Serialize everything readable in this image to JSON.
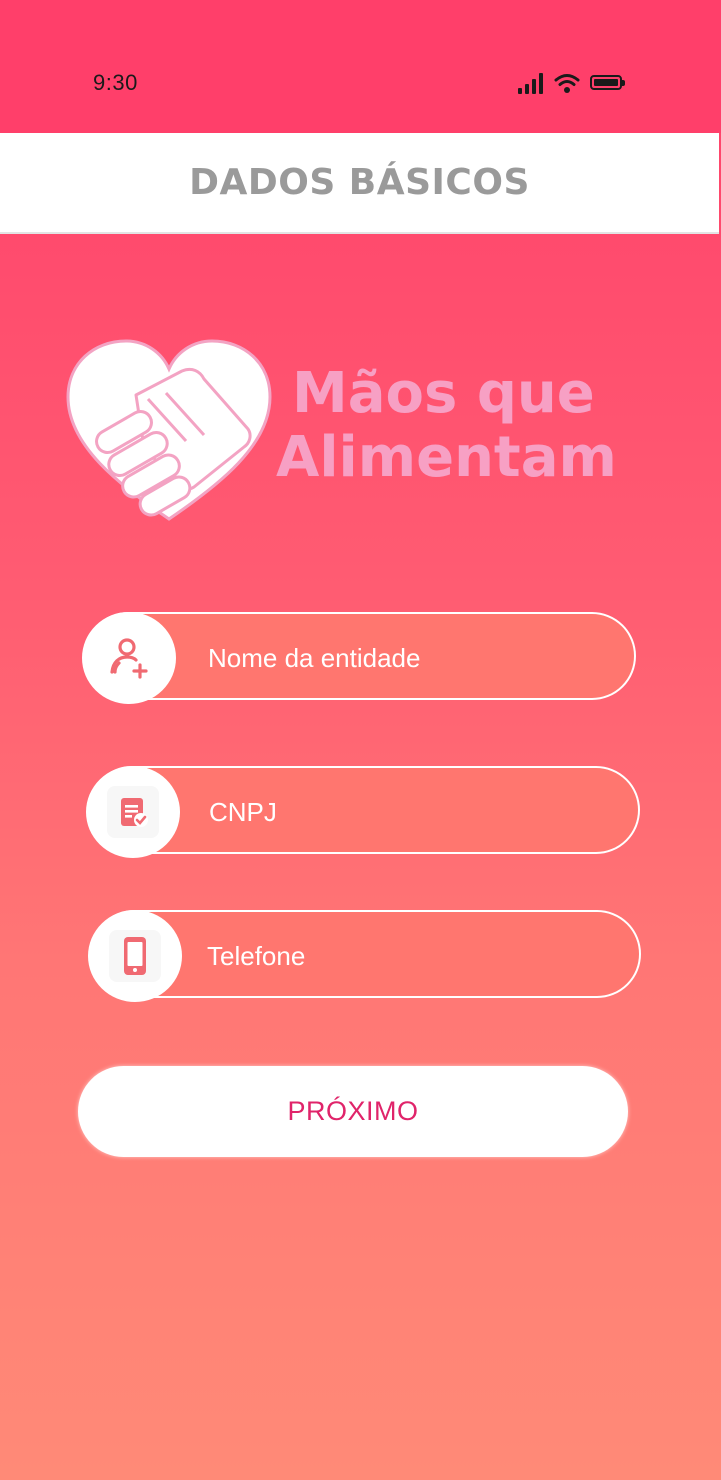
{
  "status_bar": {
    "time": "9:30",
    "icons": [
      "signal-icon",
      "wifi-icon",
      "battery-icon"
    ]
  },
  "header": {
    "title": "DADOS BÁSICOS"
  },
  "logo": {
    "line1": "Mãos que",
    "line2": "Alimentam",
    "icon": "heart-handshake-icon",
    "color": "#f7a0c4"
  },
  "form": {
    "fields": [
      {
        "label": "Nome da entidade",
        "icon": "add-user-icon"
      },
      {
        "label": "CNPJ",
        "icon": "document-check-icon"
      },
      {
        "label": "Telefone",
        "icon": "smartphone-icon"
      }
    ],
    "next_label": "PRÓXIMO"
  },
  "colors": {
    "status_bar": "#ff3f6a",
    "gradient_top": "#ff3f6a",
    "gradient_bottom": "#ff8a77",
    "accent_text": "#e0246a",
    "header_title": "#9a9a9a",
    "icon": "#f06a72"
  }
}
